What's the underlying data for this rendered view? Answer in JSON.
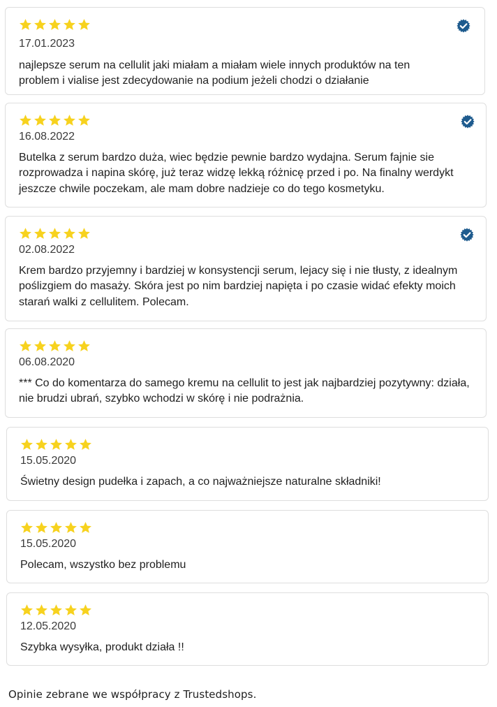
{
  "reviews": [
    {
      "rating": 5,
      "date": "17.01.2023",
      "verified": true,
      "text": "najlepsze serum na cellulit jaki miałam a miałam wiele innych produktów na ten problem i vialise jest zdecydowanie na podium jeżeli chodzi o działanie"
    },
    {
      "rating": 5,
      "date": "16.08.2022",
      "verified": true,
      "text": "Butelka z serum bardzo duża, wiec będzie pewnie bardzo wydajna. Serum fajnie sie rozprowadza i napina skórę, już teraz widzę lekką różnicę przed i po. Na finalny werdykt jeszcze chwile poczekam, ale mam dobre nadzieje co do tego kosmetyku."
    },
    {
      "rating": 5,
      "date": "02.08.2022",
      "verified": true,
      "text": "Krem bardzo przyjemny i bardziej w konsystencji serum, lejacy się i nie tłusty, z idealnym poślizgiem do masaży. Skóra jest po nim bardziej napięta i po czasie widać efekty moich starań walki z cellulitem. Polecam."
    },
    {
      "rating": 5,
      "date": "06.08.2020",
      "verified": false,
      "text": "*** Co do komentarza do samego kremu na cellulit to jest jak najbardziej pozytywny: działa, nie brudzi ubrań, szybko wchodzi w skórę i nie podrażnia."
    },
    {
      "rating": 5,
      "date": "15.05.2020",
      "verified": false,
      "text": "Świetny design pudełka i zapach, a co najważniejsze naturalne składniki!"
    },
    {
      "rating": 5,
      "date": "15.05.2020",
      "verified": false,
      "text": "Polecam, wszystko bez problemu"
    },
    {
      "rating": 5,
      "date": "12.05.2020",
      "verified": false,
      "text": "Szybka wysyłka, produkt działa !!"
    }
  ],
  "footer": {
    "note": "Opinie zebrane we współpracy z Trustedshops."
  },
  "icons": {
    "star": "star-icon",
    "verified": "verified-badge-icon"
  },
  "colors": {
    "star": "#f7d21e",
    "verified": "#1e5b8e",
    "card_border": "#dedede"
  }
}
